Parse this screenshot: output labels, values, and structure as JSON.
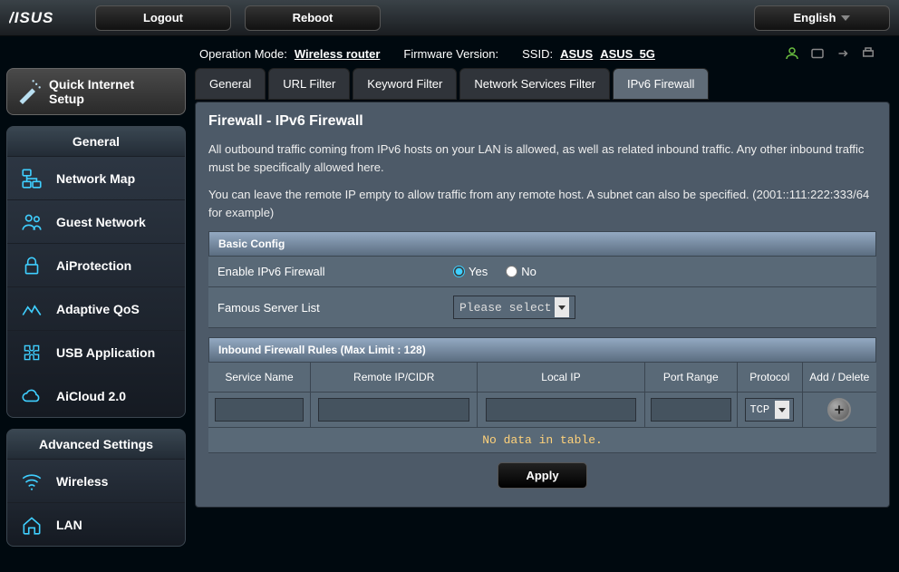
{
  "topbar": {
    "logo_text": "ASUS",
    "logout": "Logout",
    "reboot": "Reboot",
    "language": "English"
  },
  "info": {
    "op_mode_label": "Operation Mode:",
    "op_mode_value": "Wireless router",
    "fw_label": "Firmware Version:",
    "ssid_label": "SSID:",
    "ssid1": "ASUS",
    "ssid2": "ASUS_5G"
  },
  "sidebar": {
    "qis_line1": "Quick Internet",
    "qis_line2": "Setup",
    "general_header": "General",
    "general_items": [
      {
        "label": "Network Map"
      },
      {
        "label": "Guest Network"
      },
      {
        "label": "AiProtection"
      },
      {
        "label": "Adaptive QoS"
      },
      {
        "label": "USB Application"
      },
      {
        "label": "AiCloud 2.0"
      }
    ],
    "advanced_header": "Advanced Settings",
    "advanced_items": [
      {
        "label": "Wireless"
      },
      {
        "label": "LAN"
      }
    ]
  },
  "tabs": [
    {
      "label": "General"
    },
    {
      "label": "URL Filter"
    },
    {
      "label": "Keyword Filter"
    },
    {
      "label": "Network Services Filter"
    },
    {
      "label": "IPv6 Firewall"
    }
  ],
  "panel": {
    "title": "Firewall - IPv6 Firewall",
    "desc1": "All outbound traffic coming from IPv6 hosts on your LAN is allowed, as well as related inbound traffic. Any other inbound traffic must be specifically allowed here.",
    "desc2": "You can leave the remote IP empty to allow traffic from any remote host. A subnet can also be specified. (2001::111:222:333/64 for example)"
  },
  "basic": {
    "header": "Basic Config",
    "enable_label": "Enable IPv6 Firewall",
    "yes": "Yes",
    "no": "No",
    "enable_value": "yes",
    "famous_label": "Famous Server List",
    "famous_placeholder": "Please select"
  },
  "rules": {
    "header": "Inbound Firewall Rules (Max Limit : 128)",
    "cols": {
      "service": "Service Name",
      "remote": "Remote IP/CIDR",
      "local": "Local IP",
      "port": "Port Range",
      "proto": "Protocol",
      "action": "Add / Delete"
    },
    "proto_default": "TCP",
    "empty": "No data in table."
  },
  "apply": "Apply"
}
